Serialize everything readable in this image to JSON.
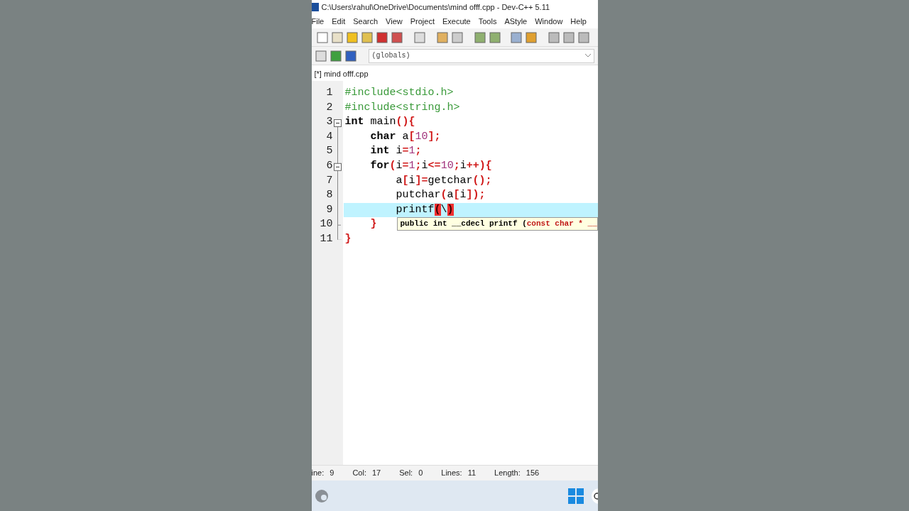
{
  "window": {
    "title": "C:\\Users\\rahul\\OneDrive\\Documents\\mind offf.cpp - Dev-C++ 5.11"
  },
  "menu": [
    "File",
    "Edit",
    "Search",
    "View",
    "Project",
    "Execute",
    "Tools",
    "AStyle",
    "Window",
    "Help"
  ],
  "scope_dropdown": {
    "value": "(globals)"
  },
  "tabs": [
    {
      "label": "[*] mind offf.cpp",
      "selected": true
    }
  ],
  "editor": {
    "lines": [
      {
        "number": "1",
        "fold_start": false,
        "current": false,
        "tokens": [
          {
            "kind": "pp",
            "text": "#include<stdio.h>"
          }
        ]
      },
      {
        "number": "2",
        "fold_start": false,
        "current": false,
        "tokens": [
          {
            "kind": "pp",
            "text": "#include<string.h>"
          }
        ]
      },
      {
        "number": "3",
        "fold_start": true,
        "current": false,
        "tokens": [
          {
            "kind": "kw",
            "text": "int"
          },
          {
            "kind": "plain",
            "text": " main"
          },
          {
            "kind": "sym",
            "text": "(){"
          }
        ]
      },
      {
        "number": "4",
        "fold_start": false,
        "current": false,
        "tokens": [
          {
            "kind": "kw",
            "text": "    char"
          },
          {
            "kind": "plain",
            "text": " a"
          },
          {
            "kind": "sym",
            "text": "["
          },
          {
            "kind": "num",
            "text": "10"
          },
          {
            "kind": "sym",
            "text": "];"
          }
        ]
      },
      {
        "number": "5",
        "fold_start": false,
        "current": false,
        "tokens": [
          {
            "kind": "kw",
            "text": "    int"
          },
          {
            "kind": "plain",
            "text": " i"
          },
          {
            "kind": "sym",
            "text": "="
          },
          {
            "kind": "num",
            "text": "1"
          },
          {
            "kind": "sym",
            "text": ";"
          }
        ]
      },
      {
        "number": "6",
        "fold_start": true,
        "current": false,
        "tokens": [
          {
            "kind": "kw",
            "text": "    for"
          },
          {
            "kind": "sym",
            "text": "("
          },
          {
            "kind": "plain",
            "text": "i"
          },
          {
            "kind": "sym",
            "text": "="
          },
          {
            "kind": "num",
            "text": "1"
          },
          {
            "kind": "sym",
            "text": ";"
          },
          {
            "kind": "plain",
            "text": "i"
          },
          {
            "kind": "sym",
            "text": "<="
          },
          {
            "kind": "num",
            "text": "10"
          },
          {
            "kind": "sym",
            "text": ";"
          },
          {
            "kind": "plain",
            "text": "i"
          },
          {
            "kind": "sym",
            "text": "++){"
          }
        ]
      },
      {
        "number": "7",
        "fold_start": false,
        "current": false,
        "tokens": [
          {
            "kind": "plain",
            "text": "        a"
          },
          {
            "kind": "sym",
            "text": "["
          },
          {
            "kind": "plain",
            "text": "i"
          },
          {
            "kind": "sym",
            "text": "]="
          },
          {
            "kind": "plain",
            "text": "getchar"
          },
          {
            "kind": "sym",
            "text": "();"
          }
        ]
      },
      {
        "number": "8",
        "fold_start": false,
        "current": false,
        "tokens": [
          {
            "kind": "plain",
            "text": "        putchar"
          },
          {
            "kind": "sym",
            "text": "("
          },
          {
            "kind": "plain",
            "text": "a"
          },
          {
            "kind": "sym",
            "text": "["
          },
          {
            "kind": "plain",
            "text": "i"
          },
          {
            "kind": "sym",
            "text": "]);"
          }
        ]
      },
      {
        "number": "9",
        "fold_start": false,
        "current": true,
        "tokens": [
          {
            "kind": "plain",
            "text": "        printf"
          },
          {
            "kind": "match",
            "text": "("
          },
          {
            "kind": "plain",
            "text": "\\"
          },
          {
            "kind": "match",
            "text": ")"
          }
        ]
      },
      {
        "number": "10",
        "fold_start": false,
        "current": false,
        "tokens": [
          {
            "kind": "sym",
            "text": "    }"
          }
        ]
      },
      {
        "number": "11",
        "fold_start": false,
        "current": false,
        "tokens": [
          {
            "kind": "sym",
            "text": "}"
          }
        ]
      }
    ],
    "tooltip": {
      "parts": [
        {
          "kind": "plain",
          "text": "public int __cdecl printf ("
        },
        {
          "kind": "sym",
          "text": "const char * __"
        }
      ]
    }
  },
  "status_bar": [
    {
      "label": "ine:",
      "value": "9"
    },
    {
      "label": "Col:",
      "value": "17"
    },
    {
      "label": "Sel:",
      "value": "0"
    },
    {
      "label": "Lines:",
      "value": "11"
    },
    {
      "label": "Length:",
      "value": "156"
    }
  ]
}
